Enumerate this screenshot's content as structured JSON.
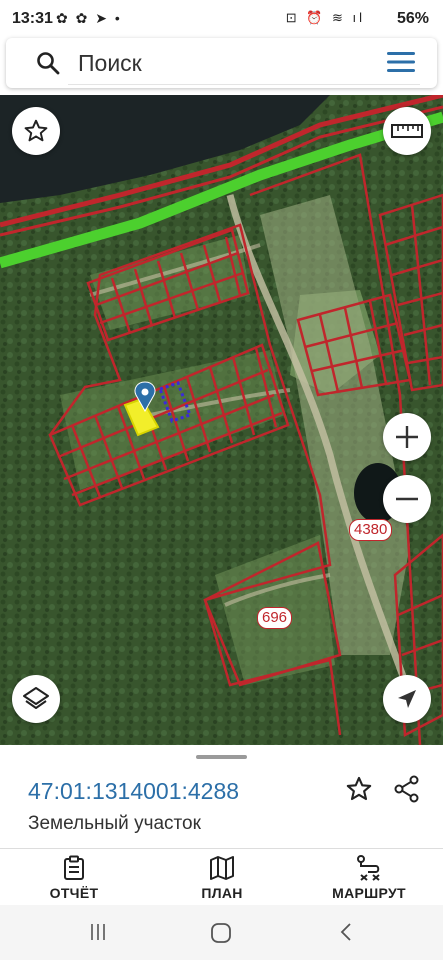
{
  "status_bar": {
    "time": "13:31",
    "left_icons": "✿ ✿ ➤ •",
    "right_icons": "⊡ ⏰ ≋ ıl",
    "battery": "56%"
  },
  "search": {
    "placeholder": "Поиск"
  },
  "map": {
    "parcel_labels": [
      "4380",
      "696"
    ]
  },
  "parcel": {
    "cadastral_number": "47:01:1314001:4288",
    "type": "Земельный участок"
  },
  "bottom_nav": {
    "report": "ОТЧЁТ",
    "plan": "ПЛАН",
    "route": "МАРШРУТ"
  },
  "colors": {
    "accent": "#2c6fa8",
    "parcel_border": "#c0262c",
    "selected_parcel": "#f2ee2a",
    "boundary_green": "#4cd02e"
  }
}
